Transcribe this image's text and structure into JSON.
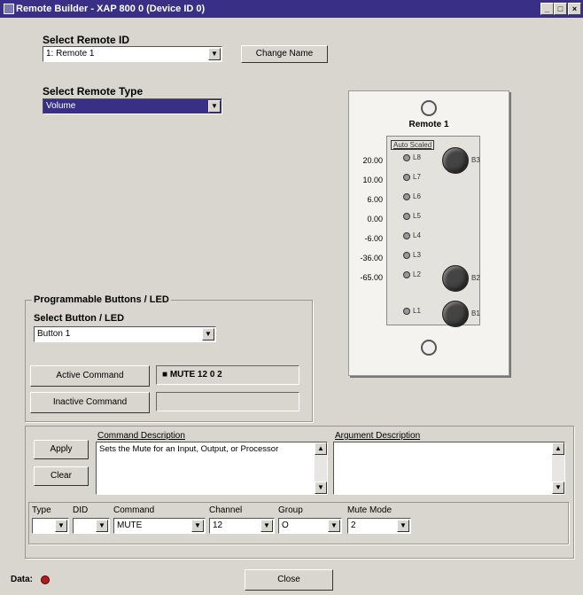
{
  "window": {
    "title": "Remote Builder - XAP 800 0 (Device ID 0)",
    "controls": [
      "_",
      "□",
      "×"
    ]
  },
  "remote_id": {
    "label": "Select Remote ID",
    "value": "1: Remote 1",
    "change_name": "Change Name"
  },
  "remote_type": {
    "label": "Select Remote Type",
    "value": "Volume"
  },
  "buttons_led": {
    "group_label": "Programmable Buttons / LED",
    "select_label": "Select Button / LED",
    "select_value": "Button 1",
    "active_label": "Active Command",
    "active_value": "■  MUTE 12 0 2",
    "inactive_label": "Inactive Command",
    "inactive_value": ""
  },
  "remote_panel": {
    "name": "Remote 1",
    "auto_scaled": "Auto Scaled",
    "levels": [
      "20.00",
      "10.00",
      "6.00",
      "0.00",
      "-6.00",
      "-36.00",
      "-65.00"
    ],
    "leds": [
      "L8",
      "L7",
      "L6",
      "L5",
      "L4",
      "L3",
      "L2",
      "L1"
    ],
    "knobs": [
      "B3",
      "B2",
      "B1"
    ]
  },
  "command": {
    "desc_label": "Command Description",
    "desc_text": "Sets the Mute for an Input, Output, or Processor",
    "arg_label": "Argument Description",
    "arg_text": "",
    "apply": "Apply",
    "clear": "Clear"
  },
  "params": {
    "type_label": "Type",
    "type_value": "",
    "did_label": "DID",
    "did_value": "",
    "command_label": "Command",
    "command_value": "MUTE",
    "channel_label": "Channel",
    "channel_value": "12",
    "group_label": "Group",
    "group_value": "O",
    "mute_label": "Mute Mode",
    "mute_value": "2"
  },
  "status": {
    "data_label": "Data:",
    "led_color": "#b51b1b"
  },
  "footer": {
    "close": "Close"
  }
}
